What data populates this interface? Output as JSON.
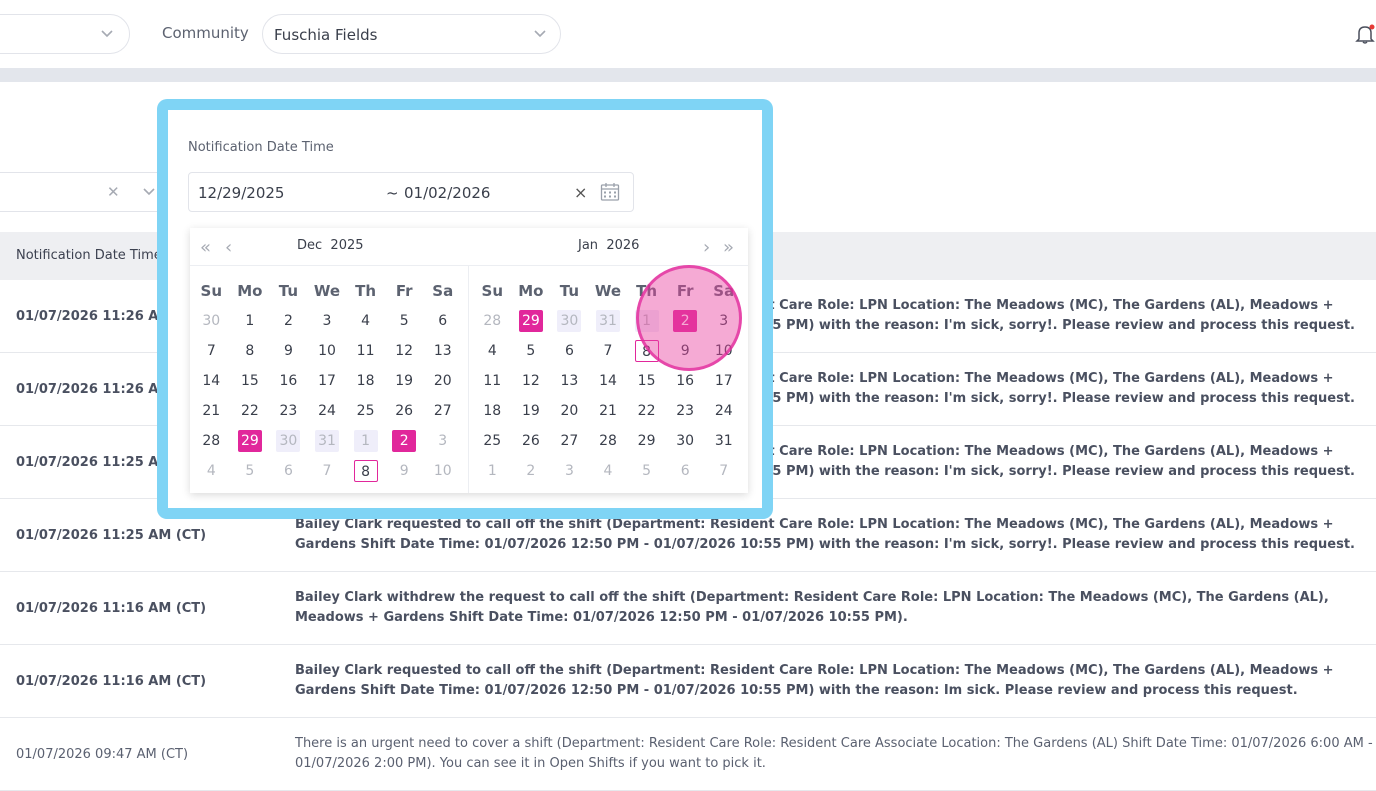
{
  "header": {
    "community_label": "Community",
    "community_value": "Fuschia Fields"
  },
  "table": {
    "col_header": "Notification Date Time",
    "rows": [
      {
        "dt": "01/07/2026 11:26 AM (CT)",
        "msg": "Bailey Clark requested to call off the shift (Department: Resident Care Role: LPN Location: The Meadows (MC), The Gardens (AL), Meadows + Gardens Shift Date Time: 01/07/2026 12:50 PM - 01/07/2026 10:55 PM) with the reason: I'm sick, sorry!. Please review and process this request.",
        "light": false
      },
      {
        "dt": "01/07/2026 11:26 AM (CT)",
        "msg": "Bailey Clark requested to call off the shift (Department: Resident Care Role: LPN Location: The Meadows (MC), The Gardens (AL), Meadows + Gardens Shift Date Time: 01/07/2026 12:50 PM - 01/07/2026 10:55 PM) with the reason: I'm sick, sorry!. Please review and process this request.",
        "light": false
      },
      {
        "dt": "01/07/2026 11:25 AM (CT)",
        "msg": "Bailey Clark requested to call off the shift (Department: Resident Care Role: LPN Location: The Meadows (MC), The Gardens (AL), Meadows + Gardens Shift Date Time: 01/07/2026 12:50 PM - 01/07/2026 10:55 PM) with the reason: I'm sick, sorry!. Please review and process this request.",
        "light": false
      },
      {
        "dt": "01/07/2026 11:25 AM (CT)",
        "msg": "Bailey Clark requested to call off the shift (Department: Resident Care Role: LPN Location: The Meadows (MC), The Gardens (AL), Meadows + Gardens Shift Date Time: 01/07/2026 12:50 PM - 01/07/2026 10:55 PM) with the reason: I'm sick, sorry!. Please review and process this request.",
        "light": false
      },
      {
        "dt": "01/07/2026 11:16 AM (CT)",
        "msg": "Bailey Clark withdrew the request to call off the shift (Department: Resident Care Role: LPN Location: The Meadows (MC), The Gardens (AL), Meadows + Gardens Shift Date Time: 01/07/2026 12:50 PM - 01/07/2026 10:55 PM).",
        "light": false
      },
      {
        "dt": "01/07/2026 11:16 AM (CT)",
        "msg": "Bailey Clark requested to call off the shift (Department: Resident Care Role: LPN Location: The Meadows (MC), The Gardens (AL), Meadows + Gardens Shift Date Time: 01/07/2026 12:50 PM - 01/07/2026 10:55 PM) with the reason: Im sick. Please review and process this request.",
        "light": false
      },
      {
        "dt": "01/07/2026 09:47 AM (CT)",
        "msg": "There is an urgent need to cover a shift (Department: Resident Care Role: Resident Care Associate Location: The Gardens (AL) Shift Date Time: 01/07/2026 6:00 AM - 01/07/2026 2:00 PM). You can see it in Open Shifts if you want to pick it.",
        "light": true
      }
    ]
  },
  "picker": {
    "label": "Notification Date Time",
    "start": "12/29/2025",
    "separator": "~",
    "end": "01/02/2026",
    "clear_icon": "×",
    "left_month": "Dec",
    "left_year": "2025",
    "right_month": "Jan",
    "right_year": "2026",
    "weekdays": [
      "Su",
      "Mo",
      "Tu",
      "We",
      "Th",
      "Fr",
      "Sa"
    ],
    "left_weeks": [
      [
        [
          "30",
          "other"
        ],
        [
          "1",
          ""
        ],
        [
          "2",
          ""
        ],
        [
          "3",
          ""
        ],
        [
          "4",
          ""
        ],
        [
          "5",
          ""
        ],
        [
          "6",
          ""
        ]
      ],
      [
        [
          "7",
          ""
        ],
        [
          "8",
          ""
        ],
        [
          "9",
          ""
        ],
        [
          "10",
          ""
        ],
        [
          "11",
          ""
        ],
        [
          "12",
          ""
        ],
        [
          "13",
          ""
        ]
      ],
      [
        [
          "14",
          ""
        ],
        [
          "15",
          ""
        ],
        [
          "16",
          ""
        ],
        [
          "17",
          ""
        ],
        [
          "18",
          ""
        ],
        [
          "19",
          ""
        ],
        [
          "20",
          ""
        ]
      ],
      [
        [
          "21",
          ""
        ],
        [
          "22",
          ""
        ],
        [
          "23",
          ""
        ],
        [
          "24",
          ""
        ],
        [
          "25",
          ""
        ],
        [
          "26",
          ""
        ],
        [
          "27",
          ""
        ]
      ],
      [
        [
          "28",
          ""
        ],
        [
          "29",
          "sel"
        ],
        [
          "30",
          "inrd"
        ],
        [
          "31",
          "inrd"
        ],
        [
          "1",
          "inr"
        ],
        [
          "2",
          "sel"
        ],
        [
          "3",
          "other"
        ]
      ],
      [
        [
          "4",
          "other"
        ],
        [
          "5",
          "other"
        ],
        [
          "6",
          "other"
        ],
        [
          "7",
          "other"
        ],
        [
          "8",
          "tod"
        ],
        [
          "9",
          "other"
        ],
        [
          "10",
          "other"
        ]
      ]
    ],
    "right_weeks": [
      [
        [
          "28",
          "other"
        ],
        [
          "29",
          "sel"
        ],
        [
          "30",
          "inr"
        ],
        [
          "31",
          "inr"
        ],
        [
          "1",
          "inrd"
        ],
        [
          "2",
          "sel"
        ],
        [
          "3",
          ""
        ]
      ],
      [
        [
          "4",
          ""
        ],
        [
          "5",
          ""
        ],
        [
          "6",
          ""
        ],
        [
          "7",
          ""
        ],
        [
          "8",
          "tod"
        ],
        [
          "9",
          ""
        ],
        [
          "10",
          ""
        ]
      ],
      [
        [
          "11",
          ""
        ],
        [
          "12",
          ""
        ],
        [
          "13",
          ""
        ],
        [
          "14",
          ""
        ],
        [
          "15",
          ""
        ],
        [
          "16",
          ""
        ],
        [
          "17",
          ""
        ]
      ],
      [
        [
          "18",
          ""
        ],
        [
          "19",
          ""
        ],
        [
          "20",
          ""
        ],
        [
          "21",
          ""
        ],
        [
          "22",
          ""
        ],
        [
          "23",
          ""
        ],
        [
          "24",
          ""
        ]
      ],
      [
        [
          "25",
          ""
        ],
        [
          "26",
          ""
        ],
        [
          "27",
          ""
        ],
        [
          "28",
          ""
        ],
        [
          "29",
          ""
        ],
        [
          "30",
          ""
        ],
        [
          "31",
          ""
        ]
      ],
      [
        [
          "1",
          "other"
        ],
        [
          "2",
          "other"
        ],
        [
          "3",
          "other"
        ],
        [
          "4",
          "other"
        ],
        [
          "5",
          "other"
        ],
        [
          "6",
          "other"
        ],
        [
          "7",
          "other"
        ]
      ]
    ]
  },
  "colors": {
    "highlight_frame": "#7fd4f5",
    "selected": "#e1279b",
    "in_range": "#efeefa",
    "circle": "#e842a0"
  }
}
